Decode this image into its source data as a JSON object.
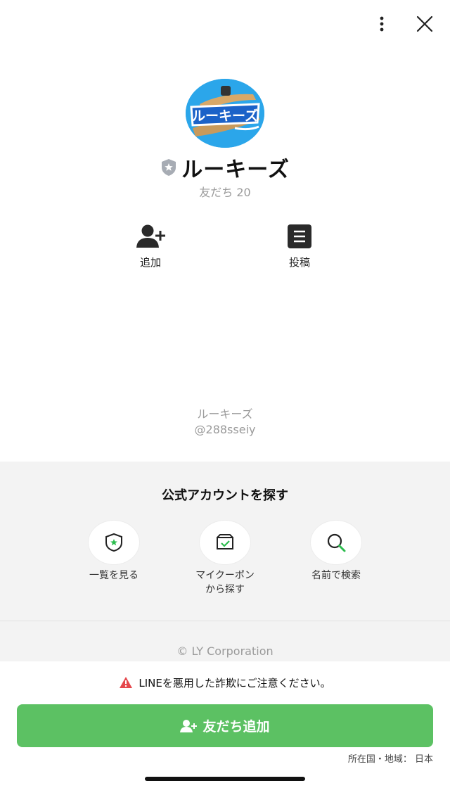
{
  "account": {
    "name": "ルーキーズ",
    "friends": "友だち 20",
    "display_name": "ルーキーズ",
    "id": "@288sseiy",
    "logo_text": "ルーキーズ"
  },
  "actions": {
    "add_label": "追加",
    "posts_label": "投稿"
  },
  "find": {
    "title": "公式アカウントを探す",
    "items": [
      {
        "label": "一覧を見る",
        "icon": "shield-star-icon"
      },
      {
        "label": "マイクーポン\nから探す",
        "icon": "coupon-icon"
      },
      {
        "label": "名前で検索",
        "icon": "search-icon"
      }
    ]
  },
  "footer": {
    "copyright": "© LY Corporation"
  },
  "bottom": {
    "warning": "LINEを悪用した詐欺にご注意ください。",
    "add_friend": "友だち追加",
    "region": "所在国・地域： 日本"
  },
  "colors": {
    "green": "#5cc163",
    "warning_red": "#e5484d",
    "section_bg": "#f3f3f3"
  }
}
